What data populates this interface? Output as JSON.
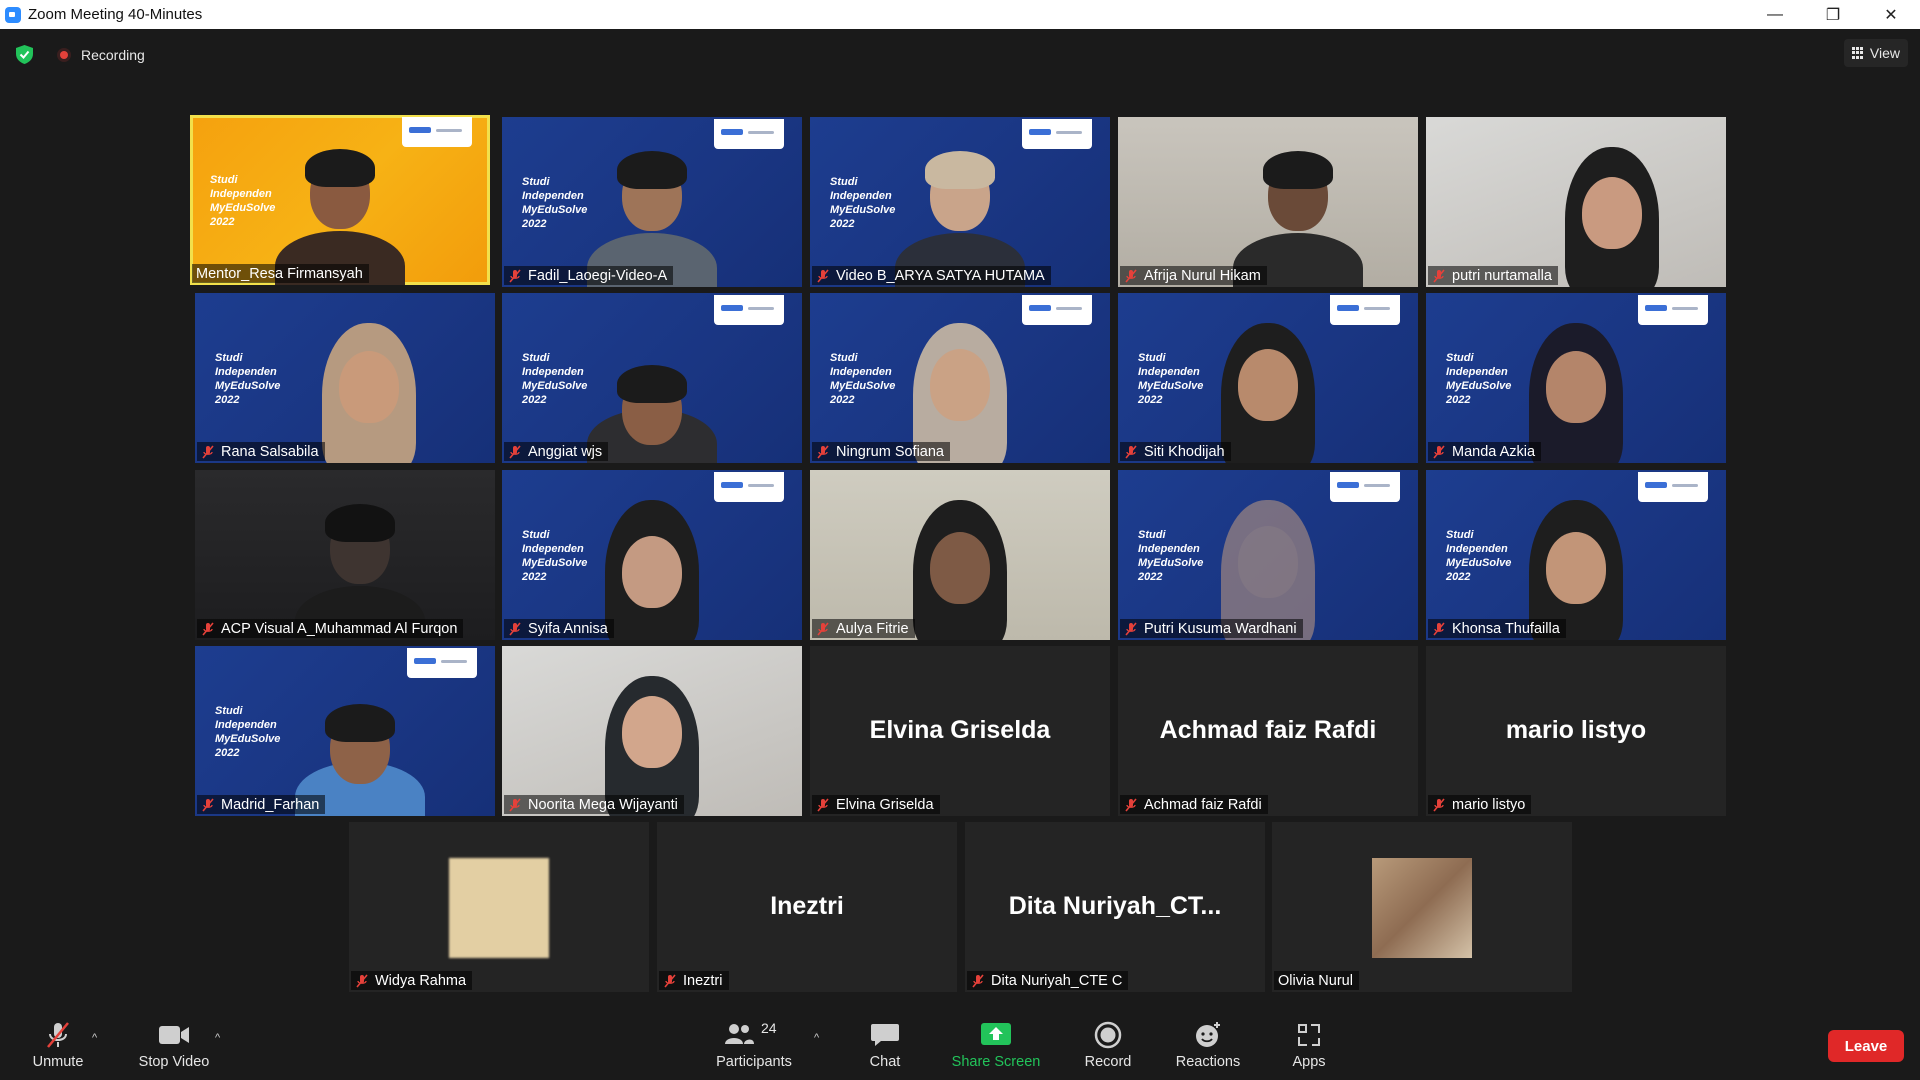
{
  "window": {
    "title": "Zoom Meeting 40-Minutes",
    "minimize": "—",
    "restore": "❐",
    "close": "✕"
  },
  "topbar": {
    "recording_label": "Recording",
    "view_label": "View"
  },
  "watermark": {
    "line1": "Studi",
    "line2": "Independen",
    "line3": "MyEduSolve",
    "line4": "2022"
  },
  "tiles": [
    {
      "name": "Mentor_Resa Firmansyah"
    },
    {
      "name": "Fadil_Laoegi-Video-A"
    },
    {
      "name": "Video B_ARYA SATYA HUTAMA"
    },
    {
      "name": "Afrija Nurul Hikam"
    },
    {
      "name": "putri nurtamalla"
    },
    {
      "name": "Rana Salsabila"
    },
    {
      "name": "Anggiat wjs"
    },
    {
      "name": "Ningrum Sofiana"
    },
    {
      "name": "Siti Khodijah"
    },
    {
      "name": "Manda Azkia"
    },
    {
      "name": "ACP Visual A_Muhammad Al Furqon"
    },
    {
      "name": "Syifa Annisa"
    },
    {
      "name": "Aulya Fitrie"
    },
    {
      "name": "Putri Kusuma Wardhani"
    },
    {
      "name": "Khonsa Thufailla"
    },
    {
      "name": "Madrid_Farhan"
    },
    {
      "name": "Noorita Mega Wijayanti"
    },
    {
      "name": "Elvina Griselda",
      "display": "Elvina Griselda"
    },
    {
      "name": "Achmad faiz Rafdi",
      "display": "Achmad faiz Rafdi"
    },
    {
      "name": "mario listyo",
      "display": "mario listyo"
    },
    {
      "name": "Widya Rahma"
    },
    {
      "name": "Ineztri",
      "display": "Ineztri"
    },
    {
      "name": "Dita Nuriyah_CTE C",
      "display": "Dita  Nuriyah_CT..."
    },
    {
      "name": "Olivia Nurul"
    }
  ],
  "toolbar": {
    "unmute": "Unmute",
    "stop_video": "Stop Video",
    "participants": "Participants",
    "participants_count": "24",
    "chat": "Chat",
    "share_screen": "Share Screen",
    "record": "Record",
    "reactions": "Reactions",
    "apps": "Apps",
    "leave": "Leave"
  },
  "colors": {
    "accent_green": "#22c35a",
    "leave_red": "#e02828",
    "active_speaker": "#f2e04b",
    "mute_red": "#e5413a"
  }
}
